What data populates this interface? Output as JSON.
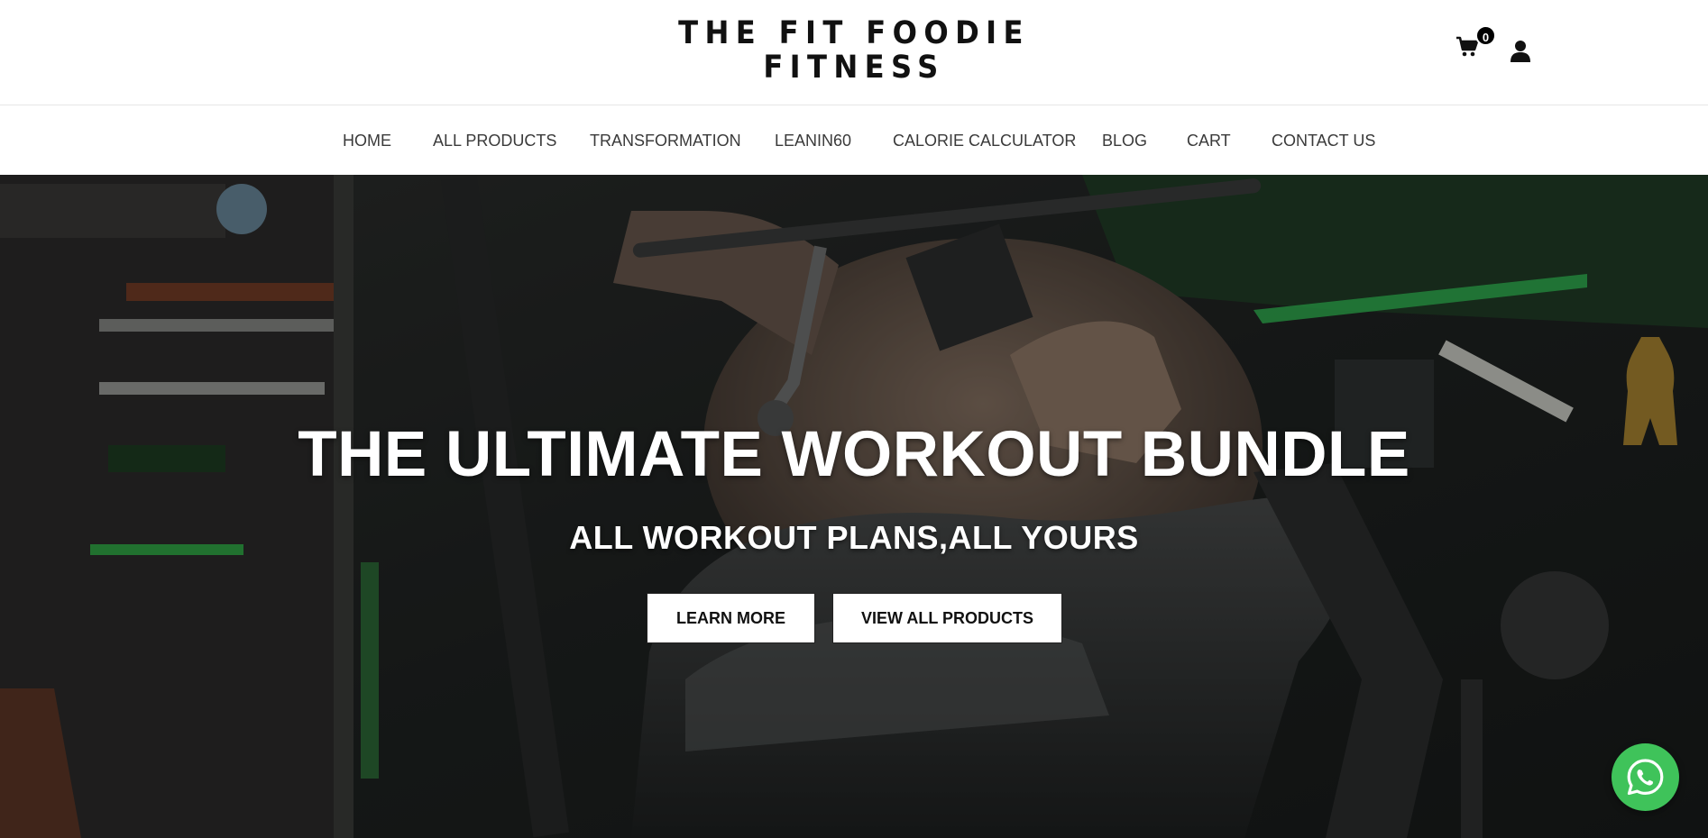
{
  "header": {
    "logo_line1": "THE FIT FOODIE",
    "logo_line2": "FITNESS",
    "cart_count": "0",
    "cart_icon": "shopping-cart-icon",
    "account_icon": "user-icon"
  },
  "nav": {
    "items": [
      {
        "label": "HOME"
      },
      {
        "label": "ALL PRODUCTS"
      },
      {
        "label": "TRANSFORMATION"
      },
      {
        "label": "LEANIN60"
      },
      {
        "label": "CALORIE CALCULATOR"
      },
      {
        "label": "BLOG"
      },
      {
        "label": "CART"
      },
      {
        "label": "CONTACT US"
      }
    ]
  },
  "hero": {
    "title": "THE ULTIMATE WORKOUT BUNDLE",
    "subtitle": "ALL WORKOUT PLANS,ALL YOURS",
    "learn_more": "LEARN MORE",
    "view_all_products": "VIEW ALL PRODUCTS"
  },
  "floating": {
    "whatsapp_icon": "whatsapp-icon",
    "whatsapp_color": "#3fc35a"
  },
  "colors": {
    "header_bg": "#ffffff",
    "nav_text": "#3a3a3a",
    "hero_text": "#ffffff",
    "accent_green": "#22c55e"
  }
}
